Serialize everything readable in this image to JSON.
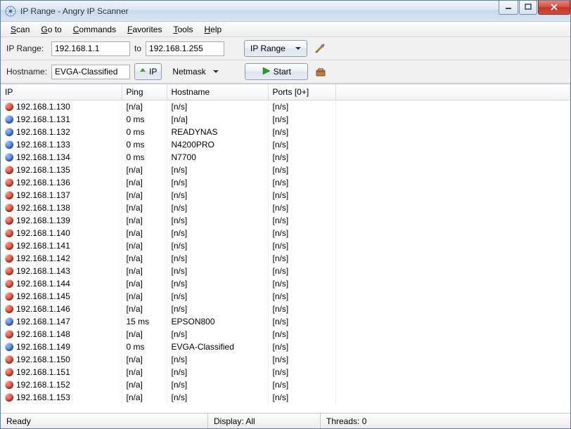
{
  "title": "IP Range - Angry IP Scanner",
  "menu": [
    "Scan",
    "Go to",
    "Commands",
    "Favorites",
    "Tools",
    "Help"
  ],
  "toolbar1": {
    "ip_range_label": "IP Range:",
    "ip_from": "192.168.1.1",
    "to_label": "to",
    "ip_to": "192.168.1.255",
    "type_label": "IP Range"
  },
  "toolbar2": {
    "hostname_label": "Hostname:",
    "hostname": "EVGA-Classified",
    "ip_btn": "IP",
    "netmask_label": "Netmask",
    "start_label": "Start"
  },
  "columns": {
    "ip": "IP",
    "ping": "Ping",
    "hostname": "Hostname",
    "ports": "Ports [0+]"
  },
  "rows": [
    {
      "ip": "192.168.1.130",
      "ping": "[n/a]",
      "hostname": "[n/s]",
      "ports": "[n/s]",
      "status": "red"
    },
    {
      "ip": "192.168.1.131",
      "ping": "0 ms",
      "hostname": "[n/a]",
      "ports": "[n/s]",
      "status": "blue"
    },
    {
      "ip": "192.168.1.132",
      "ping": "0 ms",
      "hostname": "READYNAS",
      "ports": "[n/s]",
      "status": "blue"
    },
    {
      "ip": "192.168.1.133",
      "ping": "0 ms",
      "hostname": "N4200PRO",
      "ports": "[n/s]",
      "status": "blue"
    },
    {
      "ip": "192.168.1.134",
      "ping": "0 ms",
      "hostname": "N7700",
      "ports": "[n/s]",
      "status": "blue"
    },
    {
      "ip": "192.168.1.135",
      "ping": "[n/a]",
      "hostname": "[n/s]",
      "ports": "[n/s]",
      "status": "red"
    },
    {
      "ip": "192.168.1.136",
      "ping": "[n/a]",
      "hostname": "[n/s]",
      "ports": "[n/s]",
      "status": "red"
    },
    {
      "ip": "192.168.1.137",
      "ping": "[n/a]",
      "hostname": "[n/s]",
      "ports": "[n/s]",
      "status": "red"
    },
    {
      "ip": "192.168.1.138",
      "ping": "[n/a]",
      "hostname": "[n/s]",
      "ports": "[n/s]",
      "status": "red"
    },
    {
      "ip": "192.168.1.139",
      "ping": "[n/a]",
      "hostname": "[n/s]",
      "ports": "[n/s]",
      "status": "red"
    },
    {
      "ip": "192.168.1.140",
      "ping": "[n/a]",
      "hostname": "[n/s]",
      "ports": "[n/s]",
      "status": "red"
    },
    {
      "ip": "192.168.1.141",
      "ping": "[n/a]",
      "hostname": "[n/s]",
      "ports": "[n/s]",
      "status": "red"
    },
    {
      "ip": "192.168.1.142",
      "ping": "[n/a]",
      "hostname": "[n/s]",
      "ports": "[n/s]",
      "status": "red"
    },
    {
      "ip": "192.168.1.143",
      "ping": "[n/a]",
      "hostname": "[n/s]",
      "ports": "[n/s]",
      "status": "red"
    },
    {
      "ip": "192.168.1.144",
      "ping": "[n/a]",
      "hostname": "[n/s]",
      "ports": "[n/s]",
      "status": "red"
    },
    {
      "ip": "192.168.1.145",
      "ping": "[n/a]",
      "hostname": "[n/s]",
      "ports": "[n/s]",
      "status": "red"
    },
    {
      "ip": "192.168.1.146",
      "ping": "[n/a]",
      "hostname": "[n/s]",
      "ports": "[n/s]",
      "status": "red"
    },
    {
      "ip": "192.168.1.147",
      "ping": "15 ms",
      "hostname": "EPSON800",
      "ports": "[n/s]",
      "status": "blue"
    },
    {
      "ip": "192.168.1.148",
      "ping": "[n/a]",
      "hostname": "[n/s]",
      "ports": "[n/s]",
      "status": "red"
    },
    {
      "ip": "192.168.1.149",
      "ping": "0 ms",
      "hostname": "EVGA-Classified",
      "ports": "[n/s]",
      "status": "blue"
    },
    {
      "ip": "192.168.1.150",
      "ping": "[n/a]",
      "hostname": "[n/s]",
      "ports": "[n/s]",
      "status": "red"
    },
    {
      "ip": "192.168.1.151",
      "ping": "[n/a]",
      "hostname": "[n/s]",
      "ports": "[n/s]",
      "status": "red"
    },
    {
      "ip": "192.168.1.152",
      "ping": "[n/a]",
      "hostname": "[n/s]",
      "ports": "[n/s]",
      "status": "red"
    },
    {
      "ip": "192.168.1.153",
      "ping": "[n/a]",
      "hostname": "[n/s]",
      "ports": "[n/s]",
      "status": "red"
    }
  ],
  "status": {
    "ready": "Ready",
    "display": "Display: All",
    "threads": "Threads: 0"
  }
}
